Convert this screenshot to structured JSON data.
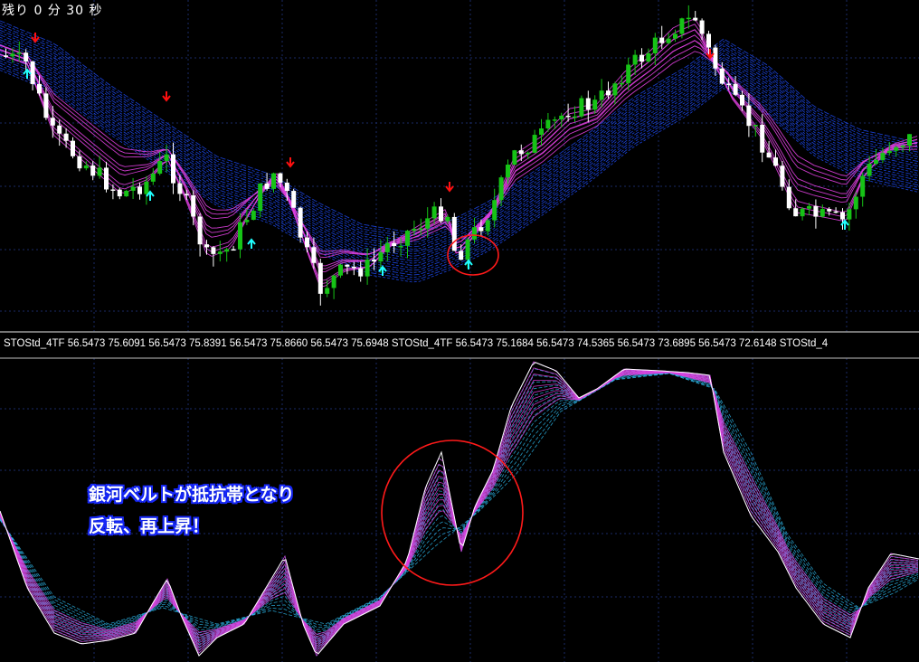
{
  "timer": {
    "text": "残り 0 分 30 秒"
  },
  "indicator": {
    "label": "STOStd_4TF 56.5473 75.6091 56.5473 75.8391 56.5473 75.8660 56.5473 75.6948 STOStd_4TF 56.5473 75.1684 56.5473 74.5365 56.5473 73.6895 56.5473 72.6148 STOStd_4"
  },
  "annotation": {
    "line1": "銀河ベルトが抵抗帯となり",
    "line2": "反転、再上昇！"
  },
  "colors": {
    "background": "#000000",
    "grid": "#1a2a66",
    "bull_candle": "#16c316",
    "bear_candle": "#ffffff",
    "magenta_band": "#e040e0",
    "blue_band": "#1f4dff",
    "cyan_band": "#30c8ff",
    "sell_arrow": "#ff1010",
    "buy_arrow": "#20ffff",
    "highlight_circle": "#ff1a1a"
  },
  "icons": [
    "sell-arrow-icon",
    "buy-arrow-icon",
    "highlight-circle"
  ]
}
